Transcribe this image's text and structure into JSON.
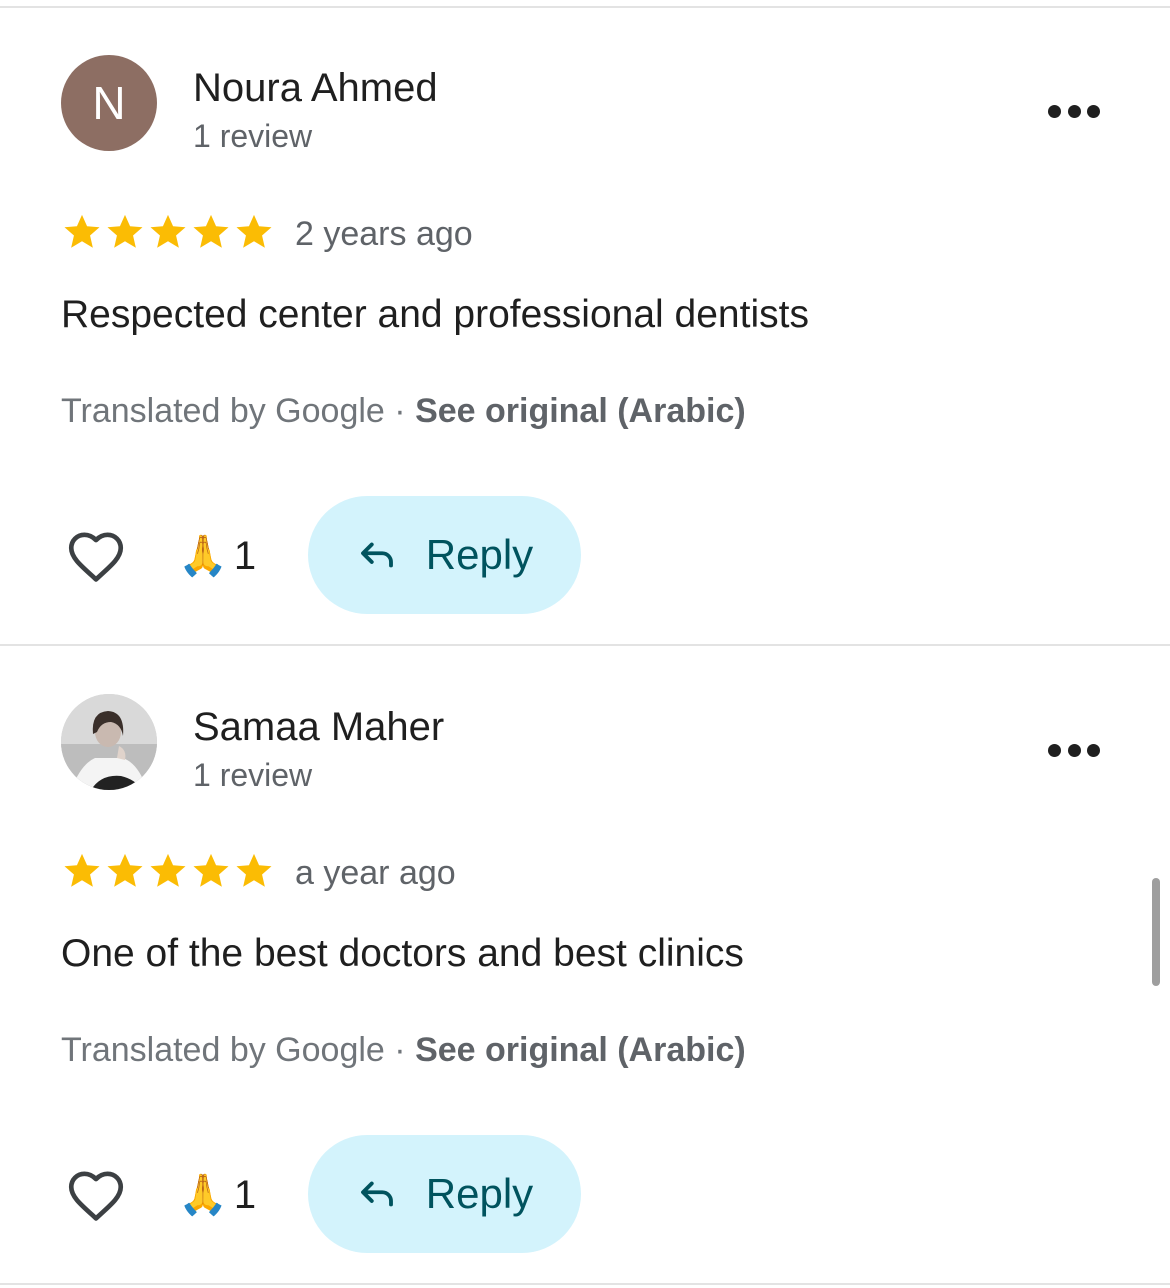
{
  "reviews": [
    {
      "author": "Noura Ahmed",
      "avatar_letter": "N",
      "avatar_color": "#8d6e63",
      "review_count": "1 review",
      "rating": 5,
      "time": "2 years ago",
      "text": "Respected center and professional dentists",
      "translated_by": "Translated by Google",
      "separator": "·",
      "see_original": "See original (Arabic)",
      "reaction_emoji": "🙏",
      "reaction_count": "1",
      "reply_label": "Reply"
    },
    {
      "author": "Samaa Maher",
      "avatar": "profile-photo",
      "review_count": "1 review",
      "rating": 5,
      "time": "a year ago",
      "text": "One of the best doctors and best clinics",
      "translated_by": "Translated by Google",
      "separator": "·",
      "see_original": "See original (Arabic)",
      "reaction_emoji": "🙏",
      "reaction_count": "1",
      "reply_label": "Reply"
    }
  ],
  "colors": {
    "star": "#fbbc04",
    "reply_bg": "#d3f3fc",
    "reply_text": "#00535e",
    "secondary_text": "#5f6368"
  }
}
